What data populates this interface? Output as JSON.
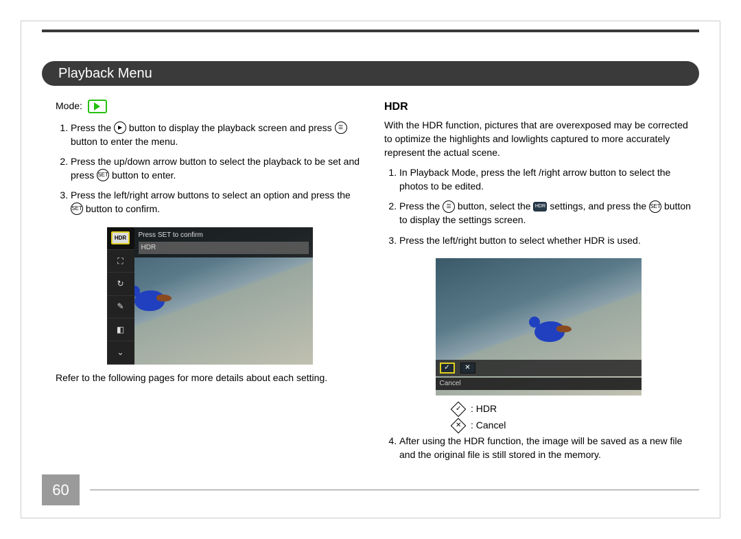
{
  "header": {
    "title": "Playback Menu"
  },
  "page_number": "60",
  "left": {
    "mode_label": "Mode:",
    "steps": [
      {
        "pre": "Press the ",
        "icon": "playback",
        "mid": " button to display the playback screen and press ",
        "icon2": "menu",
        "post": " button to enter the menu."
      },
      {
        "pre": "Press the up/down arrow button to select the playback to be set and press ",
        "icon": "set",
        "post": " button to enter."
      },
      {
        "pre": "Press the left/right arrow buttons to select an option and press the ",
        "icon": "set",
        "post": " button to confirm."
      }
    ],
    "refer": "Refer to the following pages for more details about each setting.",
    "ss": {
      "confirm_text": "Press SET to confirm",
      "hdr_text": "HDR",
      "sidebar_badge": "HDR"
    }
  },
  "right": {
    "title": "HDR",
    "intro": "With the HDR function, pictures that are overexposed may be corrected to optimize the highlights and lowlights captured to more accurately represent the actual scene.",
    "steps": [
      {
        "text": "In Playback Mode, press the left /right arrow button to select the photos to be edited."
      },
      {
        "pre": "Press the ",
        "icon": "menu",
        "mid": " button, select the ",
        "icon2": "hdr",
        "mid2": " settings, and press the ",
        "icon3": "set",
        "post": " button to display the settings screen."
      },
      {
        "text": "Press the left/right button to select whether HDR is used."
      }
    ],
    "legend": {
      "hdr": ": HDR",
      "cancel": ": Cancel"
    },
    "step4": "After using the HDR function, the image will be saved as a new file and the original file is still stored in the memory.",
    "ss": {
      "cancel": "Cancel"
    }
  }
}
